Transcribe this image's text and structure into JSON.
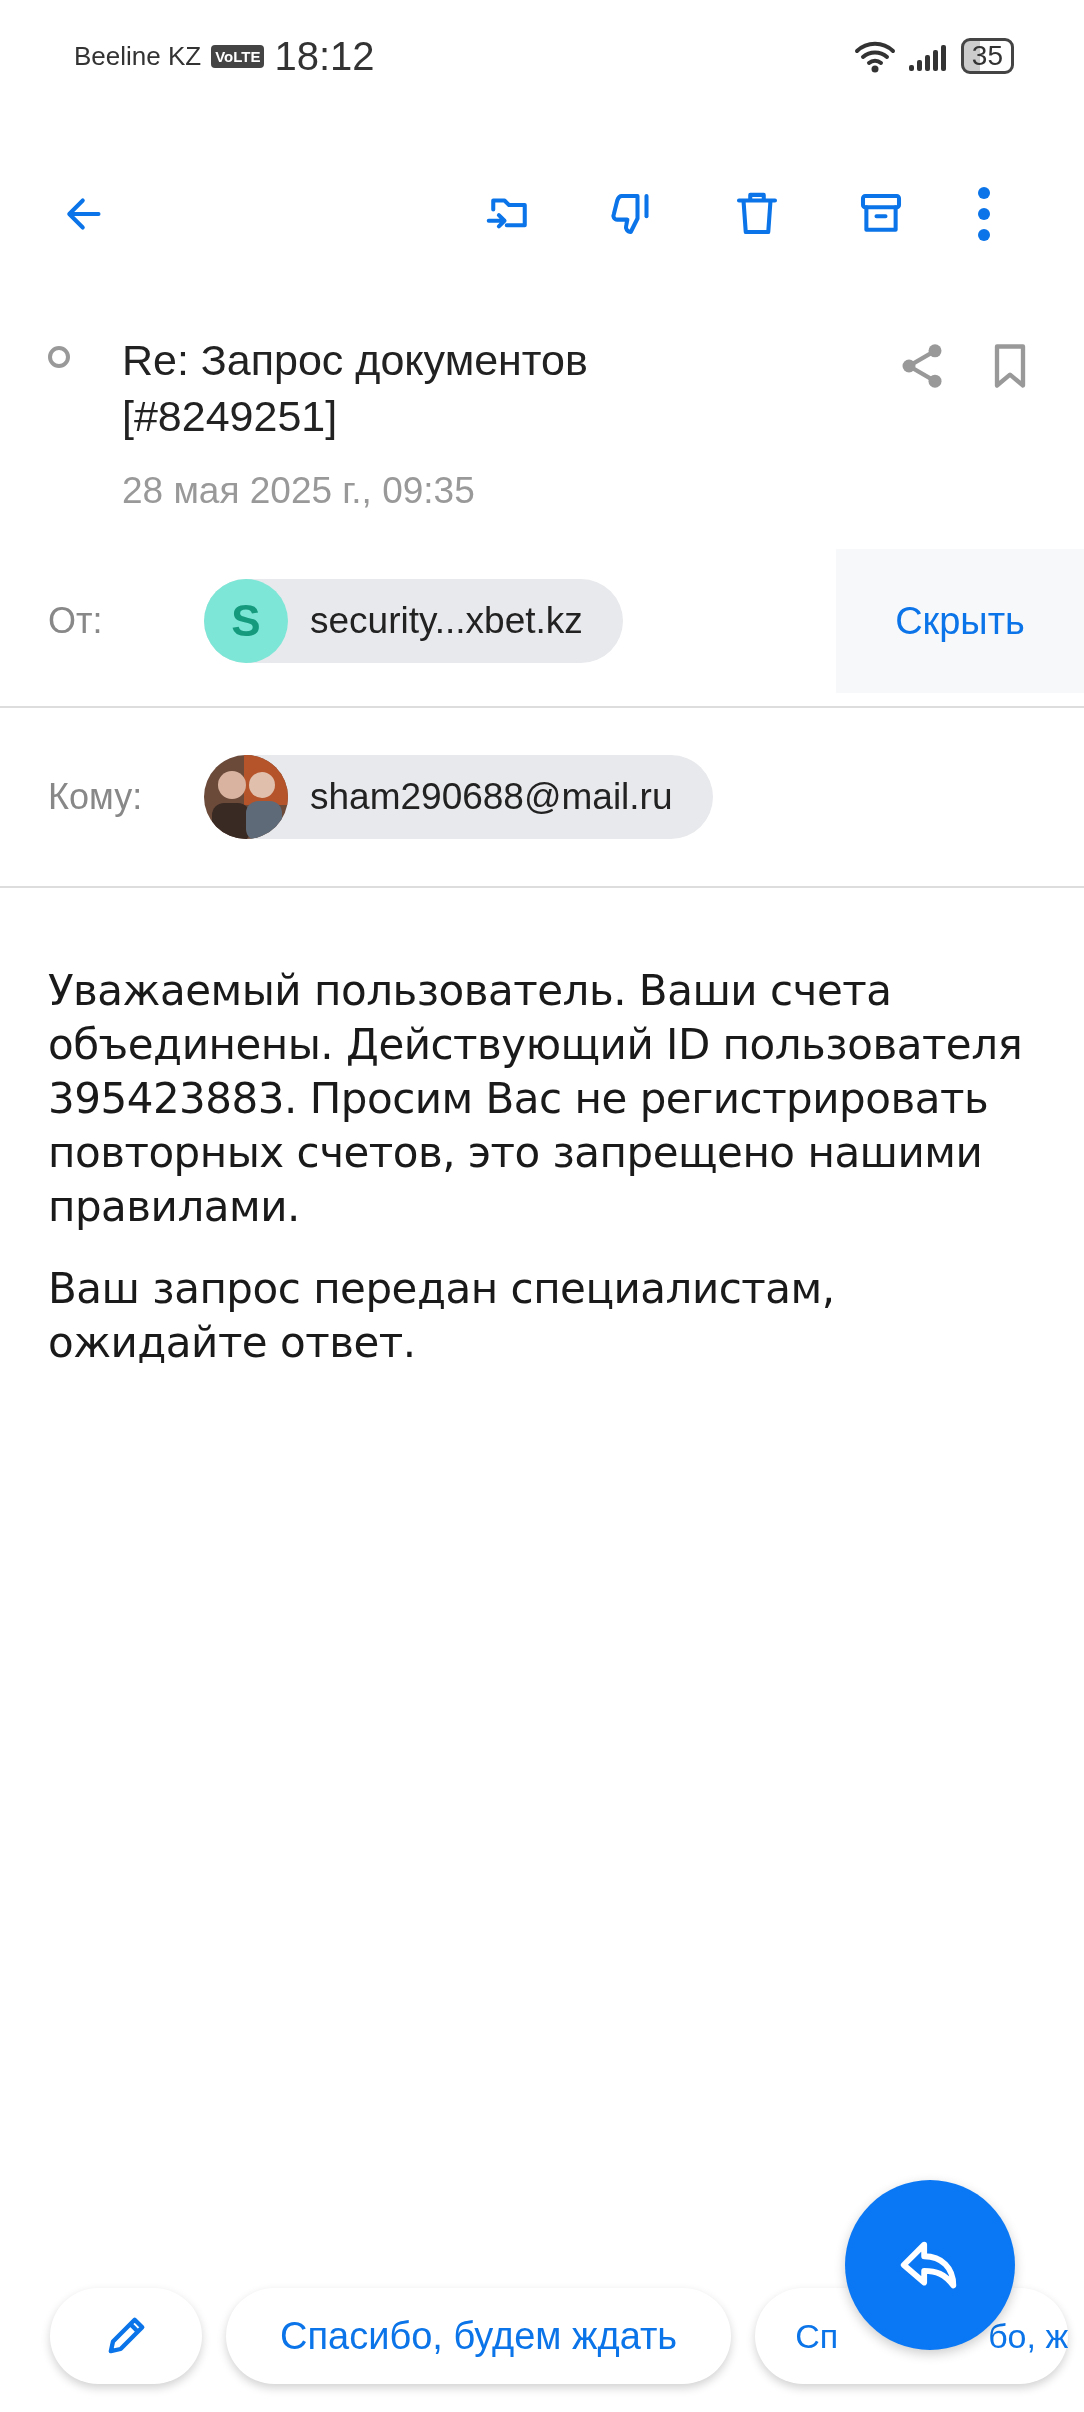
{
  "status_bar": {
    "carrier": "Beeline KZ",
    "volte": "VoLTE",
    "time": "18:12",
    "battery": "35"
  },
  "message": {
    "read": true,
    "subject": "Re: Запрос документов [#8249251]",
    "date": "28 мая 2025 г., 09:35",
    "from": {
      "label": "От:",
      "initial": "S",
      "address": "security...xbet.kz",
      "hide": "Скрыть"
    },
    "to": {
      "label": "Кому:",
      "address": "sham290688@mail.ru"
    },
    "body": [
      "Уважаемый пользователь. Ваши счета объединены. Действующий ID пользователя 395423883. Просим Вас не регистрировать повторных счетов, это запрещено нашими правилами.",
      "Ваш запрос передан специалистам, ожидайте ответ."
    ]
  },
  "quick_replies": [
    {
      "text": "Спасибо, будем ждать"
    },
    {
      "visible_parts": [
        "Сп",
        "бо, ж"
      ]
    }
  ]
}
